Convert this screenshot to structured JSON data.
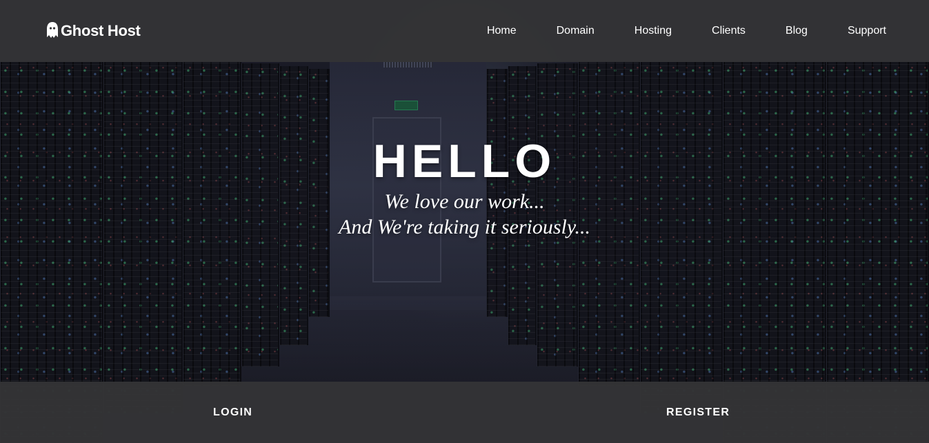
{
  "brand": {
    "name": "Ghost Host",
    "icon": "ghost-icon"
  },
  "nav": {
    "items": [
      {
        "label": "Home"
      },
      {
        "label": "Domain"
      },
      {
        "label": "Hosting"
      },
      {
        "label": "Clients"
      },
      {
        "label": "Blog"
      },
      {
        "label": "Support"
      }
    ]
  },
  "hero": {
    "heading": "HELLO",
    "line1": "We love our work...",
    "line2": "And We're taking it seriously..."
  },
  "actions": {
    "login": "LOGIN",
    "register": "REGISTER"
  },
  "colors": {
    "bar_background": "#343436",
    "text": "#ffffff",
    "hero_tint": "#1c1d28"
  }
}
